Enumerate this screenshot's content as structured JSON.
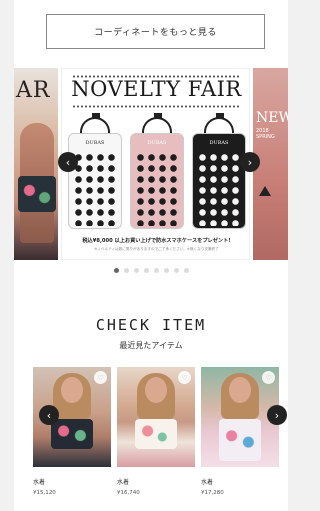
{
  "coordinate_button": {
    "label": "コーディネートをもっと見る"
  },
  "banner": {
    "left_text": "AR",
    "title": "NOVELTY FAIR",
    "case_label": "DUBAS",
    "caption": "税込¥8,000 以上お買い上げで防水スマホケースをプレゼント!",
    "note": "※ノベルティは数に限りがありますのでご了承ください。※無くなり次第終了",
    "right_text": "NEW",
    "right_year": "2018 SPRING",
    "prev_icon": "chevron-left-icon",
    "next_icon": "chevron-right-icon"
  },
  "pager": {
    "count": 8,
    "active_index": 0
  },
  "check_item": {
    "title": "CHECK ITEM",
    "subtitle": "最近見たアイテム"
  },
  "items": [
    {
      "name": "水着",
      "price": "¥15,120",
      "icon": "heart-icon"
    },
    {
      "name": "水着",
      "price": "¥16,740",
      "icon": "heart-icon"
    },
    {
      "name": "水着",
      "price": "¥17,280",
      "icon": "heart-icon"
    }
  ],
  "colors": {
    "accent": "#222222",
    "background": "#ffffff",
    "pager_active": "#666666",
    "pager_inactive": "#dcdcdc"
  }
}
